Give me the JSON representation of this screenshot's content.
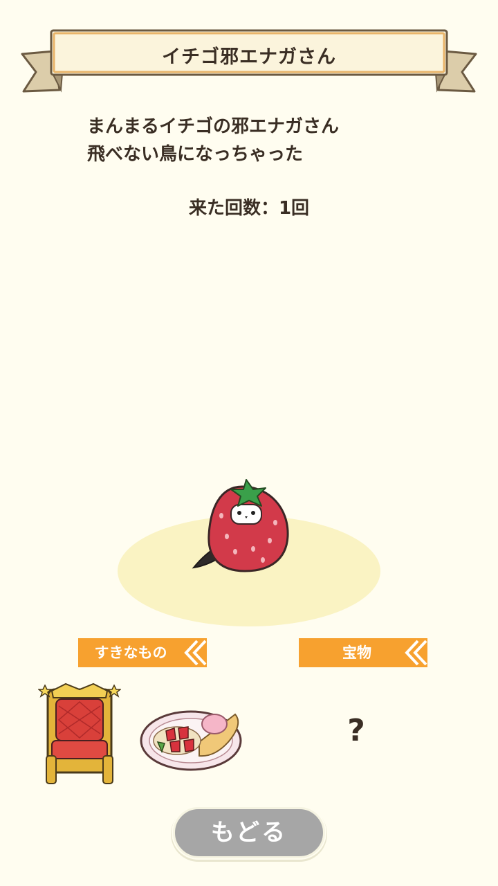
{
  "header": {
    "title": "イチゴ邪エナガさん"
  },
  "profile": {
    "description_line1": "まんまるイチゴの邪エナガさん",
    "description_line2": "飛べない鳥になっちゃった",
    "visit_count": "来た回数：1回"
  },
  "sections": {
    "favorites_label": "すきなもの",
    "treasure_label": "宝物",
    "treasure_value": "?"
  },
  "favorites": [
    {
      "icon": "throne-icon"
    },
    {
      "icon": "strawberry-crepe-dish-icon"
    }
  ],
  "footer": {
    "back_label": "もどる"
  },
  "colors": {
    "background": "#fffdf0",
    "label_orange": "#f7a12f",
    "button_gray": "#a6a6a6",
    "text": "#3a2e24"
  }
}
